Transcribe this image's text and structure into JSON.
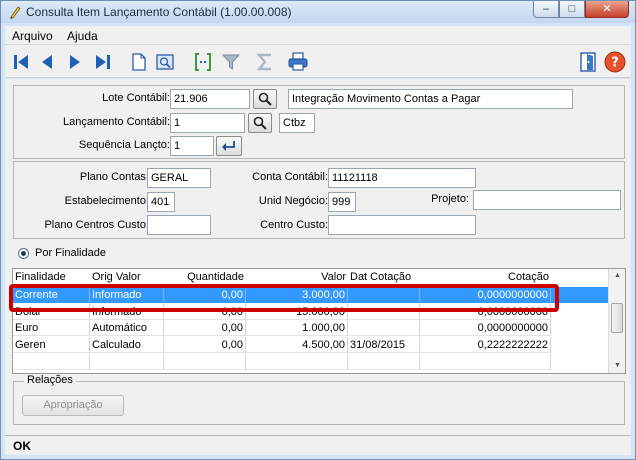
{
  "window": {
    "title": "Consulta Item Lançamento Contábil (1.00.00.008)",
    "controls": {
      "minimize": "–",
      "maximize": "□",
      "close": "✕"
    }
  },
  "menu": {
    "items": [
      "Arquivo",
      "Ajuda"
    ]
  },
  "toolbar": {
    "buttons": [
      "first-record-icon",
      "previous-record-icon",
      "next-record-icon",
      "last-record-icon",
      "new-document-icon",
      "preview-icon",
      "select-range-icon",
      "filter-icon",
      "sum-icon",
      "print-icon",
      "exit-door-icon",
      "help-icon"
    ],
    "help_symbol": "?"
  },
  "header": {
    "lote_label": "Lote Contábil:",
    "lote_value": "21.906",
    "lote_desc": "Integração Movimento Contas a Pagar",
    "lancamento_label": "Lançamento Contábil:",
    "lancamento_value": "1",
    "lancamento_desc": "Ctbz",
    "sequencia_label": "Sequência Lançto:",
    "sequencia_value": "1"
  },
  "details": {
    "plano_contas_label": "Plano Contas:",
    "plano_contas_value": "GERAL",
    "conta_contabil_label": "Conta Contábil:",
    "conta_contabil_value": "11121118",
    "estabelecimento_label": "Estabelecimento:",
    "estabelecimento_value": "401",
    "unid_negocio_label": "Unid Negócio:",
    "unid_negocio_value": "999",
    "projeto_label": "Projeto:",
    "projeto_value": "",
    "plano_centros_label": "Plano Centros Custo:",
    "plano_centros_value": "",
    "centro_custo_label": "Centro Custo:",
    "centro_custo_value": ""
  },
  "radio": {
    "label": "Por Finalidade",
    "checked": true
  },
  "grid": {
    "columns": [
      "Finalidade",
      "Orig Valor",
      "Quantidade",
      "Valor",
      "Dat Cotação",
      "Cotação"
    ],
    "rows": [
      [
        "Corrente",
        "Informado",
        "0,00",
        "3.000,00",
        "",
        "0,0000000000"
      ],
      [
        "Dolar",
        "Informado",
        "0,00",
        "15.000,00",
        "",
        "0,0000000000"
      ],
      [
        "Euro",
        "Automático",
        "0,00",
        "1.000,00",
        "",
        "0,0000000000"
      ],
      [
        "Geren",
        "Calculado",
        "0,00",
        "4.500,00",
        "31/08/2015",
        "0,2222222222"
      ]
    ],
    "selected_row": 0
  },
  "relacoes": {
    "title": "Relações",
    "apropriacao_label": "Apropriação"
  },
  "status": {
    "text": "OK"
  },
  "colors": {
    "selection": "#3399ff",
    "highlight": "#cc0000",
    "accent": "#1f5fb8"
  }
}
